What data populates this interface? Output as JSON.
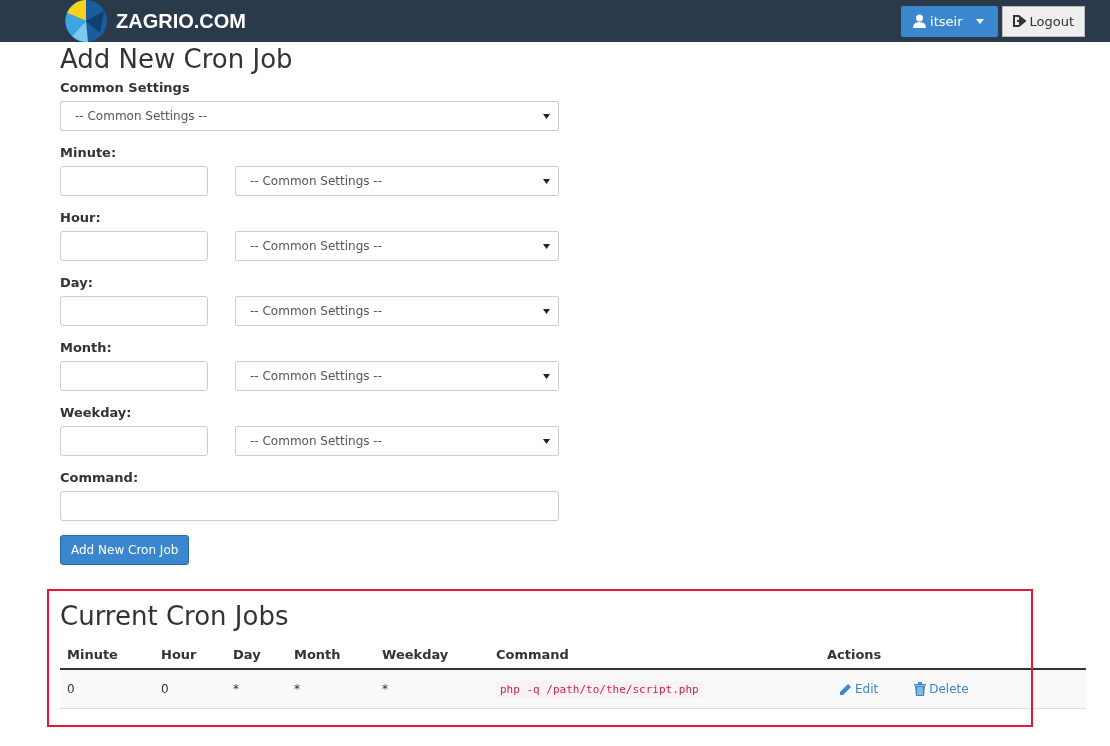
{
  "header": {
    "logo": "ZAGRIO.COM",
    "user_menu": "itseir",
    "logout": "Logout"
  },
  "form": {
    "title": "Add New Cron Job",
    "common": {
      "label": "Common Settings",
      "value": "-- Common Settings --"
    },
    "fields": [
      {
        "kind": "pair",
        "label": "Minute:",
        "value": "-- Common Settings --"
      },
      {
        "kind": "pair",
        "label": "Hour:",
        "value": "-- Common Settings --"
      },
      {
        "kind": "pair",
        "label": "Day:",
        "value": "-- Common Settings --"
      },
      {
        "kind": "pair",
        "label": "Month:",
        "value": "-- Common Settings --"
      },
      {
        "kind": "pair",
        "label": "Weekday:",
        "value": "-- Common Settings --"
      },
      {
        "kind": "text",
        "label": "Command:"
      }
    ],
    "submit": "Add New Cron Job"
  },
  "jobs": {
    "title": "Current Cron Jobs",
    "highlighted": true,
    "columns": [
      "Minute",
      "Hour",
      "Day",
      "Month",
      "Weekday",
      "Command",
      "Actions"
    ],
    "rows": [
      {
        "minute": "0",
        "hour": "0",
        "day": "*",
        "month": "*",
        "weekday": "*",
        "command": "php -q /path/to/the/script.php",
        "edit": "Edit",
        "delete": "Delete"
      }
    ]
  }
}
